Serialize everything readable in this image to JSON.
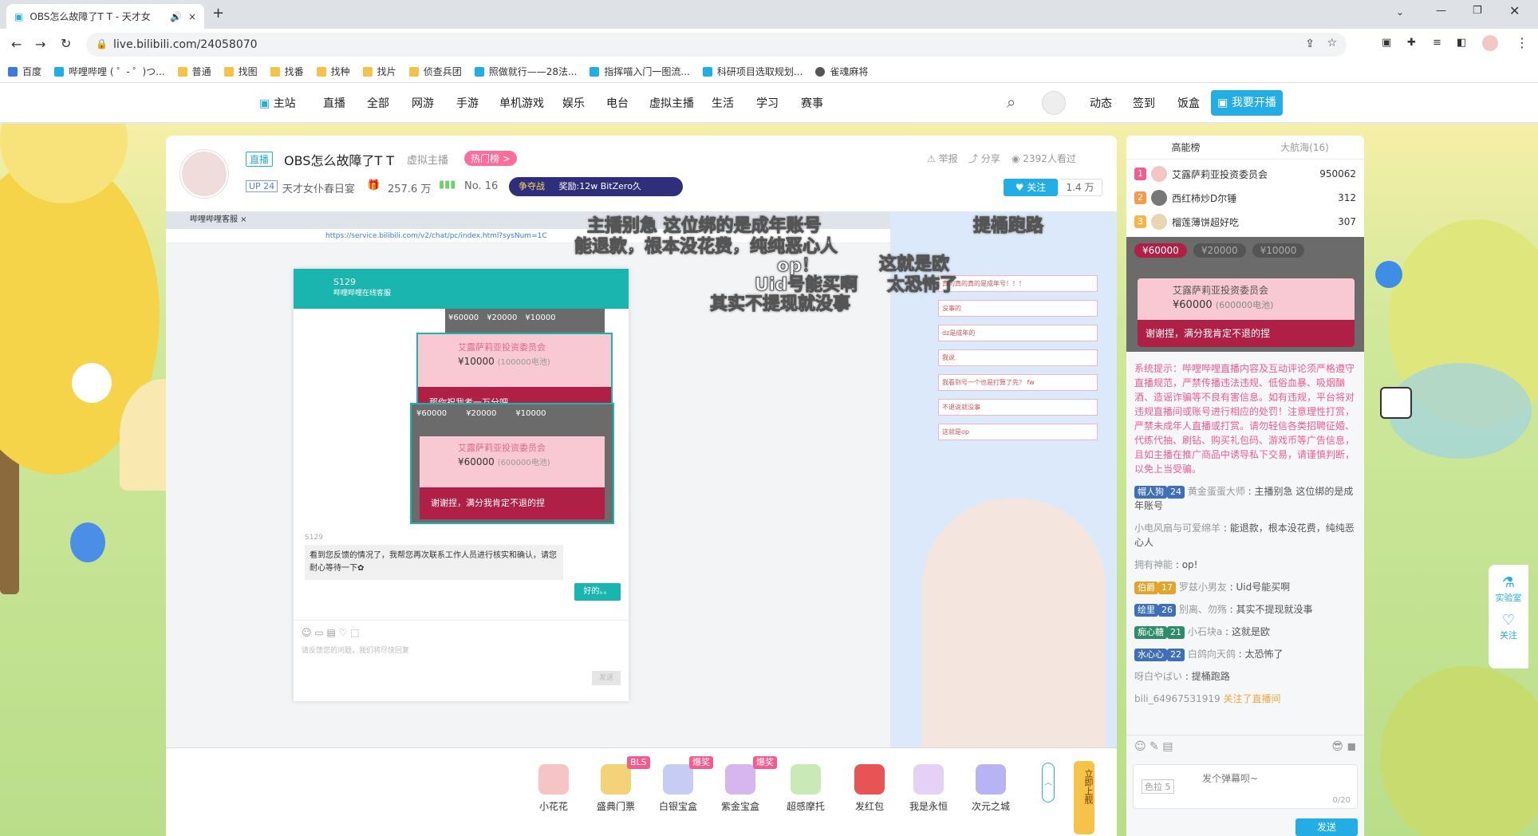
{
  "browser": {
    "tab_title": "OBS怎么故障了T T - 天才女",
    "url": "live.bilibili.com/24058070",
    "bookmarks": [
      "百度",
      "哔哩哔哩 ( ゜- ゜)つ...",
      "普通",
      "找图",
      "找番",
      "找种",
      "找片",
      "侦查兵团",
      "照做就行——28法...",
      "指挥喵入门一图流...",
      "科研项目选取规划...",
      "雀魂麻将"
    ]
  },
  "nav": {
    "items": [
      "主站",
      "直播",
      "全部",
      "网游",
      "手游",
      "单机游戏",
      "娱乐",
      "电台",
      "虚拟主播",
      "生活",
      "学习",
      "赛事"
    ],
    "right": [
      "动态",
      "签到",
      "饭盒"
    ],
    "start_live": "我要开播"
  },
  "room": {
    "live_badge": "直播",
    "title": "OBS怎么故障了T T",
    "category": "虚拟主播",
    "hot_badge": "热门榜 >",
    "up_level": "UP 24",
    "streamer": "天才女仆春日宴",
    "gift_count": "257.6 万",
    "rank": "No. 16",
    "banner_left": "争夺战",
    "banner_text": "奖励:12w BitZero久",
    "report": "举报",
    "share": "分享",
    "viewers": "2392人看过",
    "follow": "关注",
    "followers": "1.4 万"
  },
  "video": {
    "inner_tab": "哔哩哔哩客服 ×",
    "inner_url": "https://service.bilibili.com/v2/chat/pc/index.html?sysNum=1C",
    "agent_name": "S129",
    "agent_sub": "哔哩哔哩在线客服",
    "gift_tiers": [
      "¥60000",
      "¥20000",
      "¥10000"
    ],
    "card1_user": "艾露萨莉亚投资委员会",
    "card1_amount": "¥10000",
    "card1_note": "(100000电池)",
    "card1_msg": "那你祝我考一万分吧",
    "card2_user": "艾露萨莉亚投资委员会",
    "card2_amount": "¥60000",
    "card2_note": "(600000电池)",
    "card2_msg": "谢谢捏，满分我肯定不退的捏",
    "agent_label": "S129",
    "agent_msg": "看到您反馈的情况了，我帮您再次联系工作人员进行核实和确认，请您耐心等待一下✿",
    "user_msg": "好的。。",
    "input_placeholder": "请反馈您的问题，我们将尽快回复",
    "send": "发送",
    "overlay_items": [
      "真的真的真的是成年号！！！",
      "没事的",
      "dz是成年的",
      "我说",
      "我看到号一个也是打算了先？ fw",
      "不退说就没事",
      "这就是op"
    ],
    "danmaku": [
      "主播别急 这位绑的是成年账号",
      "能退款，根本没花费，纯纯恶心人",
      "op！",
      "Uid号能买啊",
      "其实不提现就没事",
      "这就是欧",
      "太恐怖了",
      "提桶跑路"
    ]
  },
  "gifts": {
    "items": [
      "小花花",
      "盛典门票",
      "白银宝盒",
      "紫金宝盒",
      "超感摩托",
      "发红包",
      "我是永恒",
      "次元之城"
    ],
    "badges": [
      "BLS",
      "爆奖",
      "爆奖"
    ],
    "side_label": "立即上舰"
  },
  "rank_panel": {
    "tabs": [
      "高能榜",
      "大航海(16)"
    ],
    "rows": [
      {
        "name": "艾露萨莉亚投资委员会",
        "value": "950062"
      },
      {
        "name": "西红柿炒D尔锤",
        "value": "312"
      },
      {
        "name": "榴莲薄饼超好吃",
        "value": "307"
      }
    ],
    "sc_tiers": [
      "¥60000",
      "¥20000",
      "¥10000"
    ],
    "sc_user": "艾露萨莉亚投资委员会",
    "sc_amount": "¥60000",
    "sc_note": "(600000电池)",
    "sc_msg": "谢谢捏，满分我肯定不退的捏"
  },
  "chat": {
    "system": "系统提示：哔哩哔哩直播内容及互动评论须严格遵守直播规范，严禁传播违法违规、低俗血暴、吸烟酗酒、造谣诈骗等不良有害信息。如有违规，平台将对违规直播间或账号进行相应的处罚！注意理性打赏，严禁未成年人直播或打赏。请勿轻信各类招聘征婚、代练代抽、刷钻、购买礼包码、游戏币等广告信息，且如主播在推广商品中诱导私下交易，请谨慎判断，以免上当受骗。",
    "messages": [
      {
        "medal": "帽人狗",
        "lvl": "24",
        "user": "黄金蛋蛋大师",
        "text": "主播别急 这位绑的是成年账号"
      },
      {
        "medal": "",
        "lvl": "",
        "user": "小电风扇与可爱绵羊",
        "text": "能退款，根本没花费，纯纯恶心人"
      },
      {
        "medal": "",
        "lvl": "",
        "user": "拥有神能",
        "text": "op!"
      },
      {
        "medal": "伯爵",
        "lvl": "17",
        "user": "罗兹小男友",
        "text": "Uid号能买啊"
      },
      {
        "medal": "绘里",
        "lvl": "26",
        "user": "别离、勿殇",
        "text": "其实不提现就没事"
      },
      {
        "medal": "痴心糖",
        "lvl": "21",
        "user": "小石块a",
        "text": "这就是欧"
      },
      {
        "medal": "水心心",
        "lvl": "22",
        "user": "白鸽向天鸽",
        "text": "太恐怖了"
      },
      {
        "medal": "",
        "lvl": "",
        "user": "呀白やばい",
        "text": "提桶跑路"
      }
    ],
    "follow_user": "bili_64967531919",
    "follow_text": "关注了直播间",
    "input_placeholder": "发个弹幕呗~",
    "counter": "0/20",
    "color_label": "色拉",
    "color_lvl": "5",
    "send": "发送"
  },
  "side_float": {
    "lab": "实验室",
    "follow": "关注"
  }
}
